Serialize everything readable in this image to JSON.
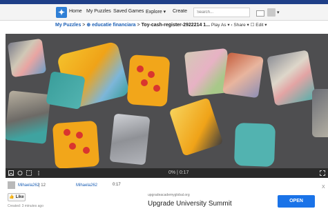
{
  "nav": {
    "logo": "✦",
    "links": [
      "Home",
      "My Puzzles",
      "Saved Games",
      "Explore ▾",
      "Create"
    ],
    "search_placeholder": "Search...",
    "user_menu": "▾"
  },
  "breadcrumb": {
    "root": "My Puzzles",
    "separator": " > ",
    "folder": "⊕ educatie financiara",
    "title": "Toy-cash-register-2922214 1...",
    "actions": [
      " Play As ▾",
      "  ‹ Share ▾",
      "  ☐ Edit ▾"
    ]
  },
  "controls": {
    "progress": "0% | 0:17"
  },
  "author": {
    "name": "Mihaela262",
    "count": "| 12",
    "solver": "Mihaela262",
    "time": "0:17"
  },
  "like_label": "Like",
  "created": "Created: 3 minutes ago",
  "ad": {
    "url": "upgradeacademyglobal.org",
    "title": "Upgrade University Summit",
    "open_label": "OPEN",
    "close": "X"
  },
  "colors": {
    "board": "#4e4e50",
    "brand_blue": "#1f3f88",
    "link_blue": "#1b5fb5",
    "ad_button": "#1a73e8"
  }
}
